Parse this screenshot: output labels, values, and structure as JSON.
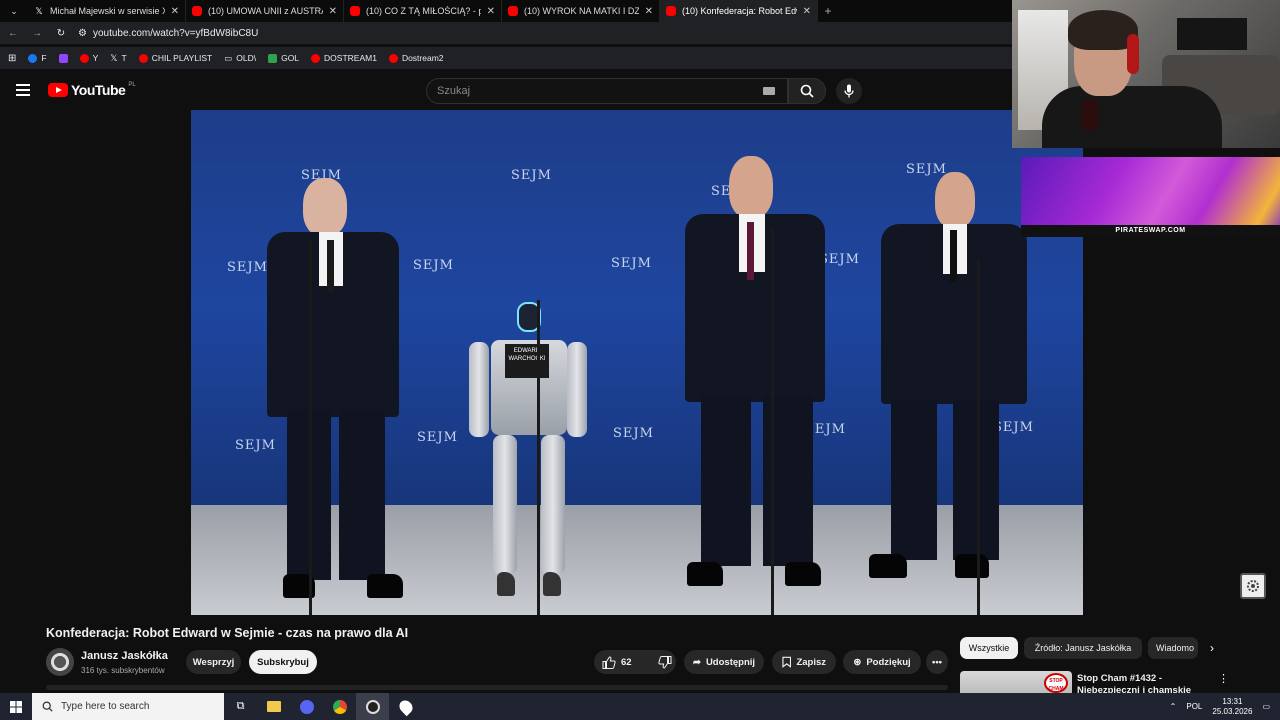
{
  "browser": {
    "tabs": [
      {
        "title": "Michał Majewski w serwisie X: „",
        "favicon": "x-icon",
        "active": false
      },
      {
        "title": "(10) UMOWA UNII z AUSTRALIĄ",
        "favicon": "youtube-icon",
        "active": false
      },
      {
        "title": "(10) CO Z TĄ MIŁOŚCIĄ? - pole",
        "favicon": "youtube-icon",
        "active": false
      },
      {
        "title": "(10) WYROK NA MATKI I DZIEC",
        "favicon": "youtube-icon",
        "active": false
      },
      {
        "title": "(10) Konfederacja: Robot Edwa",
        "favicon": "youtube-icon",
        "active": true
      }
    ],
    "url": "youtube.com/watch?v=yfBdW8ibC8U",
    "bookmarks": [
      {
        "label": "F",
        "color": "#1877f2"
      },
      {
        "label": "",
        "color": "#9146ff"
      },
      {
        "label": "Y",
        "color": "#ff0000"
      },
      {
        "label": "T",
        "color": "#ffffff"
      },
      {
        "label": "CHIL PLAYLIST",
        "color": "#ff0000"
      },
      {
        "label": "OLD\\",
        "color": "#cccccc"
      },
      {
        "label": "GOL",
        "color": "#2ea44f"
      },
      {
        "label": "DOSTREAM1",
        "color": "#ff0000"
      },
      {
        "label": "Dostream2",
        "color": "#ff0000"
      }
    ]
  },
  "youtube": {
    "logo_text": "YouTube",
    "country_code": "PL",
    "search_placeholder": "Szukaj"
  },
  "video": {
    "backdrop_text": "SEJM",
    "robot_sign": "EDWARD WARCHOCKI"
  },
  "info": {
    "title": "Konfederacja: Robot Edward w Sejmie - czas na prawo dla AI",
    "channel_name": "Janusz Jaskółka",
    "subscribers": "316 tys. subskrybentów",
    "support_label": "Wesprzyj",
    "subscribe_label": "Subskrybuj",
    "like_count": "62",
    "share_label": "Udostępnij",
    "save_label": "Zapisz",
    "thanks_label": "Podziękuj"
  },
  "chips": [
    "Wszystkie",
    "Źródło: Janusz Jaskółka",
    "Wiadomo"
  ],
  "recommendation": {
    "title": "Stop Cham #1432 - Niebezpieczni i chamskie",
    "badge": "STOP CHAM"
  },
  "overlay": {
    "promo_label": "PIRATESWAP.COM"
  },
  "taskbar": {
    "search_placeholder": "Type here to search",
    "language": "POL",
    "time": "13:31",
    "date": "25.03.2026"
  }
}
